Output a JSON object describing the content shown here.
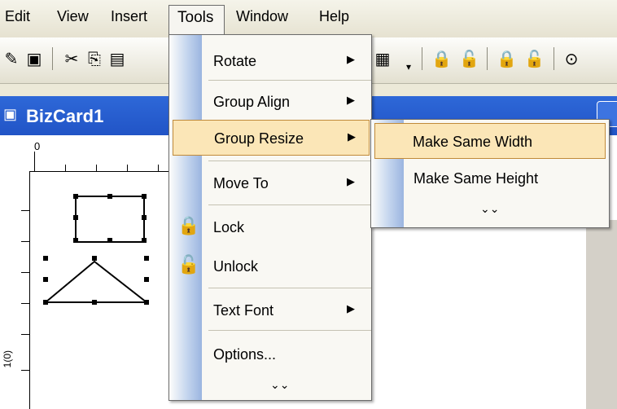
{
  "menubar": {
    "items": [
      "Edit",
      "View",
      "Insert",
      "Tools",
      "Window",
      "Help"
    ]
  },
  "document": {
    "title": "BizCard1"
  },
  "ruler": {
    "top_label": "0",
    "left_label": "1(0)"
  },
  "tools_menu": {
    "items": [
      {
        "label": "Rotate",
        "submenu": true
      },
      {
        "label": "Group Align",
        "submenu": true
      },
      {
        "label": "Group Resize",
        "submenu": true,
        "highlighted": true
      },
      {
        "label": "Move To",
        "submenu": true
      },
      {
        "label": "Lock",
        "icon": "lock-icon"
      },
      {
        "label": "Unlock",
        "icon": "unlock-icon"
      },
      {
        "label": "Text Font",
        "submenu": true
      },
      {
        "label": "Options..."
      }
    ],
    "expand": "»"
  },
  "group_resize_submenu": {
    "items": [
      {
        "label": "Make Same Width",
        "highlighted": true
      },
      {
        "label": "Make Same Height"
      }
    ],
    "expand": "»"
  },
  "colors": {
    "menu_highlight": "#FBE6B7",
    "title_bar": "#2154C6",
    "gutter": "#9BB5E0"
  }
}
